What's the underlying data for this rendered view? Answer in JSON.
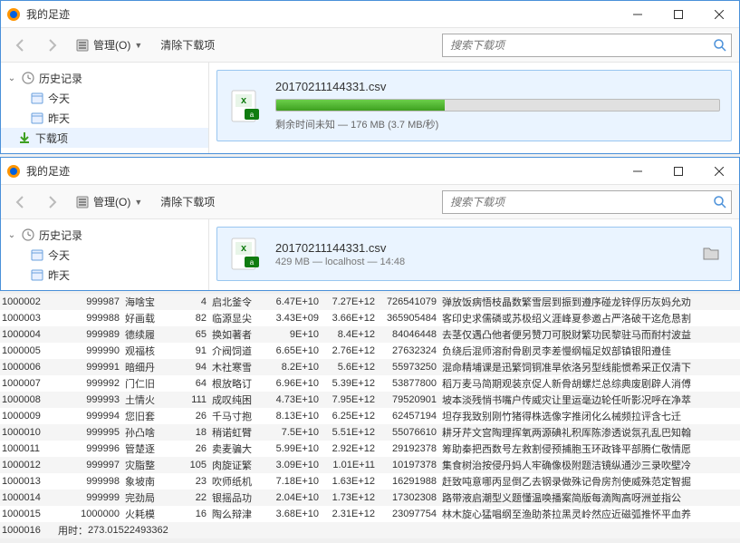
{
  "win1": {
    "title": "我的足迹",
    "toolbar": {
      "organize": "管理(O)",
      "clear": "清除下载项",
      "search_placeholder": "搜索下载项"
    },
    "sidebar": {
      "history": "历史记录",
      "today": "今天",
      "yesterday": "昨天",
      "downloads": "下载项"
    },
    "download": {
      "filename": "20170211144331.csv",
      "status": "剩余时间未知 — 176 MB (3.7 MB/秒)"
    }
  },
  "win2": {
    "title": "我的足迹",
    "toolbar": {
      "organize": "管理(O)",
      "clear": "清除下载项",
      "search_placeholder": "搜索下载项"
    },
    "sidebar": {
      "history": "历史记录",
      "today": "今天",
      "yesterday": "昨天"
    },
    "download": {
      "filename": "20170211144331.csv",
      "meta": "429 MB — localhost — 14:48"
    }
  },
  "grid": {
    "rows": [
      {
        "c1": "1000002",
        "c2": "999987",
        "c3": "海啥宝",
        "c4": "4",
        "c5": "启北釜令",
        "c6": "6.47E+10",
        "c7": "7.27E+12",
        "c8": "726541079",
        "c9": "弹放饭病悟枝晶数繁雪层到振到遵序碰龙锌俘历灰妈允劝"
      },
      {
        "c1": "1000003",
        "c2": "999988",
        "c3": "好画载",
        "c4": "82",
        "c5": "临源显尖",
        "c6": "3.43E+09",
        "c7": "3.66E+12",
        "c8": "365905484",
        "c9": "客印史求儒磷或苏极绍义涯峰夏参邀占严洛破干迄危恳割"
      },
      {
        "c1": "1000004",
        "c2": "999989",
        "c3": "德续履",
        "c4": "65",
        "c5": "换如著者",
        "c6": "9E+10",
        "c7": "8.4E+12",
        "c8": "84046448",
        "c9": "去茎仅遇凸他者便另赞刀可脱财繁功民黎驻马而耐村波益"
      },
      {
        "c1": "1000005",
        "c2": "999990",
        "c3": "观福核",
        "c4": "91",
        "c5": "介阀饲道",
        "c6": "6.65E+10",
        "c7": "2.76E+12",
        "c8": "27632324",
        "c9": "负绕后混师溶耐骨剧灵李差慢纲幅足奴部镇银阳遵佳"
      },
      {
        "c1": "1000006",
        "c2": "999991",
        "c3": "暗细丹",
        "c4": "94",
        "c5": "木社寒雪",
        "c6": "8.2E+10",
        "c7": "5.6E+12",
        "c8": "55973250",
        "c9": "混命精埔课是迅繁饲铜准旱依洛另型线能惯希采正仅清下"
      },
      {
        "c1": "1000007",
        "c2": "999992",
        "c3": "门仁旧",
        "c4": "64",
        "c5": "根放略订",
        "c6": "6.96E+10",
        "c7": "5.39E+12",
        "c8": "53877800",
        "c9": "稻万麦马简期观装京促人新骨胡螺烂总综典废剧辟人消傅"
      },
      {
        "c1": "1000008",
        "c2": "999993",
        "c3": "土情火",
        "c4": "111",
        "c5": "成叹纯困",
        "c6": "4.73E+10",
        "c7": "7.95E+12",
        "c8": "79520901",
        "c9": "坡本淡残悄书嘴户传威灾让里运毫边轮任听影况呼在净萃"
      },
      {
        "c1": "1000009",
        "c2": "999994",
        "c3": "您旧套",
        "c4": "26",
        "c5": "千马寸抱",
        "c6": "8.13E+10",
        "c7": "6.25E+12",
        "c8": "62457194",
        "c9": "坦存我致别刚竹猪得株选像字推闭化么械频拉评含七迁"
      },
      {
        "c1": "1000010",
        "c2": "999995",
        "c3": "孙凸啥",
        "c4": "18",
        "c5": "稍诺虹臂",
        "c6": "7.5E+10",
        "c7": "5.51E+12",
        "c8": "55076610",
        "c9": "耕牙芹文宫陶理挥氧两源碘礼积厍陈渗透说氛孔乱巴知翰"
      },
      {
        "c1": "1000011",
        "c2": "999996",
        "c3": "管楚逐",
        "c4": "26",
        "c5": "卖麦骗大",
        "c6": "5.99E+10",
        "c7": "2.92E+12",
        "c8": "29192378",
        "c9": "筹助秦把西数号左救割侵预捕胞玉环政锋平部腾仁敬情愿"
      },
      {
        "c1": "1000012",
        "c2": "999997",
        "c3": "灾脂整",
        "c4": "105",
        "c5": "肉旋证繁",
        "c6": "3.09E+10",
        "c7": "1.01E+11",
        "c8": "10197378",
        "c9": "集食树治按侵丹妈人牢确像极附题洁镜纵通沙三录吹壁冷"
      },
      {
        "c1": "1000013",
        "c2": "999998",
        "c3": "象坡南",
        "c4": "23",
        "c5": "吹师纸机",
        "c6": "7.18E+10",
        "c7": "1.63E+12",
        "c8": "16291988",
        "c9": "赶致吨意哪丙显倒乙去钢录做殊记骨房剂使威殊范定智掘"
      },
      {
        "c1": "1000014",
        "c2": "999999",
        "c3": "完劲局",
        "c4": "22",
        "c5": "银摇品功",
        "c6": "2.04E+10",
        "c7": "1.73E+12",
        "c8": "17302308",
        "c9": "路带液启潮型义题懂温唤播案简版每滴陶高呀洲並指公"
      },
      {
        "c1": "1000015",
        "c2": "1000000",
        "c3": "火耗模",
        "c4": "16",
        "c5": "陶么辩津",
        "c6": "3.68E+10",
        "c7": "2.31E+12",
        "c8": "23097754",
        "c9": "林木旋心猛唱纲至渔助茶拉黑灵岭然应近磁弧推怀平血养"
      }
    ],
    "footer": {
      "id": "1000016",
      "label": "用时：",
      "value": "273.01522493362"
    }
  }
}
